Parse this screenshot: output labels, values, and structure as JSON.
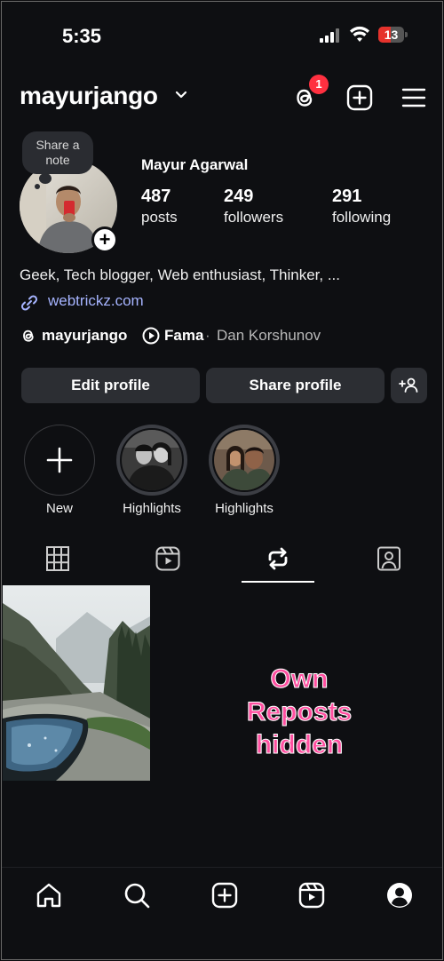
{
  "status_bar": {
    "time": "5:35",
    "battery": "13",
    "battery_color": "#e6322c"
  },
  "header": {
    "username": "mayurjango",
    "threads_badge": "1",
    "icons": [
      "threads-icon",
      "create-icon",
      "menu-icon"
    ]
  },
  "profile": {
    "note_text": "Share a note",
    "full_name": "Mayur Agarwal",
    "stats": [
      {
        "value": "487",
        "label": "posts"
      },
      {
        "value": "249",
        "label": "followers"
      },
      {
        "value": "291",
        "label": "following"
      }
    ],
    "bio": "Geek, Tech blogger, Web enthusiast, Thinker, ...",
    "link": "webtrickz.com",
    "threads_handle": "mayurjango",
    "song": "Fama",
    "separator": "·",
    "artist": "Dan Korshunov"
  },
  "buttons": {
    "edit": "Edit profile",
    "share": "Share profile"
  },
  "highlights": [
    {
      "label": "New"
    },
    {
      "label": "Highlights"
    },
    {
      "label": "Highlights"
    }
  ],
  "tabs": [
    "grid-icon",
    "reels-icon",
    "reposts-icon",
    "tagged-icon"
  ],
  "active_tab": "reposts",
  "annotation": {
    "line1": "Own",
    "line2": "Reposts",
    "line3": "hidden",
    "color": "#ff4fa0"
  },
  "bottom_nav": [
    "home-icon",
    "search-icon",
    "create-icon",
    "reels-icon",
    "profile-icon"
  ]
}
